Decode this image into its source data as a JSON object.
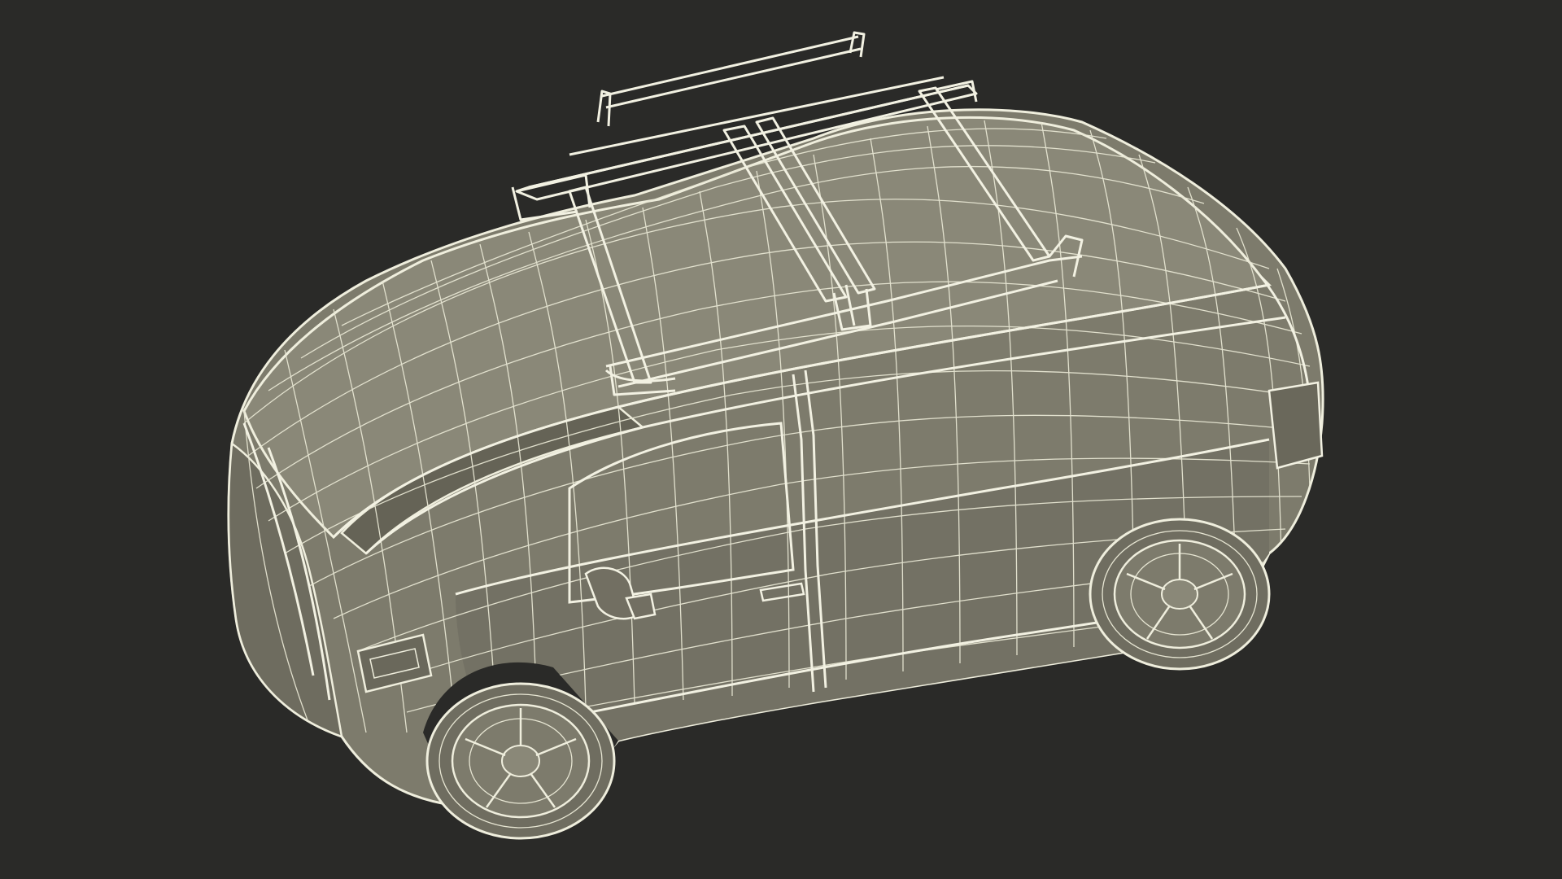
{
  "scene": {
    "subject_icon": "van-wireframe-icon",
    "colors": {
      "background": "#2a2a28",
      "surface": "#7d7b6c",
      "surface_shadow": "#656356",
      "roof": "#8a8878",
      "wire": "#efeedd",
      "wire_dim": "#d9d7c4",
      "tire": "#6f6d60"
    }
  }
}
